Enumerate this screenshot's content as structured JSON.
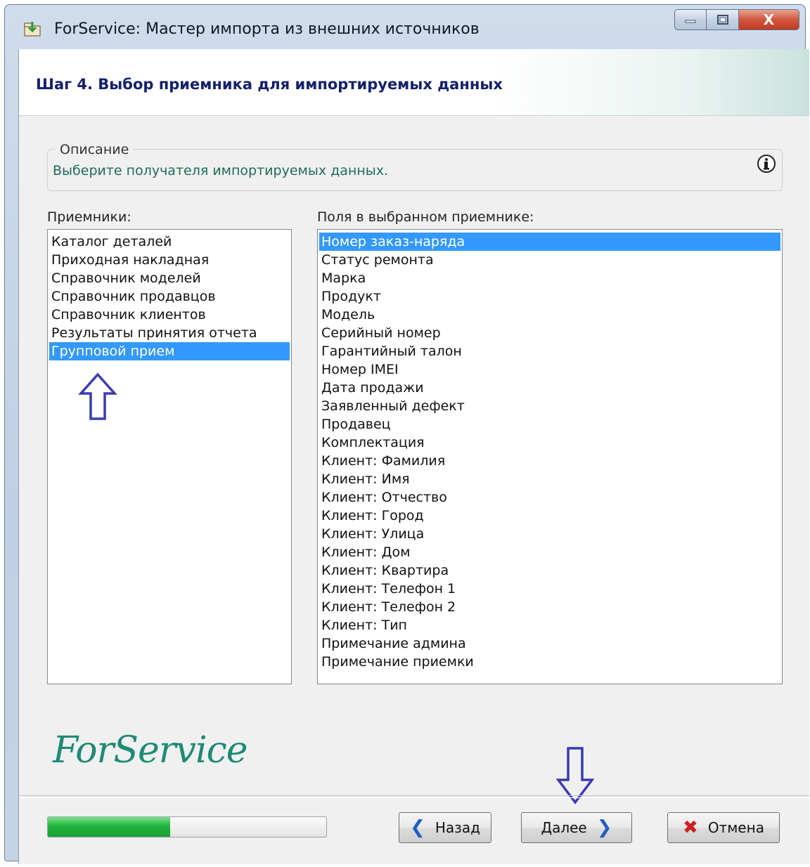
{
  "window": {
    "title": "ForService: Мастер импорта из внешних источников",
    "controls": {
      "minimize": "—",
      "maximize": "□",
      "close": "X"
    }
  },
  "header": {
    "step_title": "Шаг 4. Выбор приемника для импортируемых данных"
  },
  "description": {
    "legend": "Описание",
    "text": "Выберите получателя импортируемых данных."
  },
  "receivers": {
    "label": "Приемники:",
    "items": [
      "Каталог деталей",
      "Приходная накладная",
      "Справочник моделей",
      "Справочник продавцов",
      "Справочник клиентов",
      "Результаты принятия отчета",
      "Групповой прием"
    ],
    "selected_index": 6
  },
  "fields": {
    "label": "Поля в выбранном приемнике:",
    "items": [
      "Номер заказ-наряда",
      "Статус ремонта",
      "Марка",
      "Продукт",
      "Модель",
      "Серийный номер",
      "Гарантийный талон",
      "Номер IMEI",
      "Дата продажи",
      "Заявленный дефект",
      "Продавец",
      "Комплектация",
      "Клиент: Фамилия",
      "Клиент: Имя",
      "Клиент: Отчество",
      "Клиент: Город",
      "Клиент: Улица",
      "Клиент: Дом",
      "Клиент: Квартира",
      "Клиент: Телефон 1",
      "Клиент: Телефон 2",
      "Клиент: Тип",
      "Примечание админа",
      "Примечание приемки"
    ],
    "selected_index": 0
  },
  "logo": {
    "text": "ForService"
  },
  "progress": {
    "value": 0.44
  },
  "buttons": {
    "back": "Назад",
    "next": "Далее",
    "cancel": "Отмена"
  },
  "colors": {
    "selection": "#3399ff",
    "step_title": "#14206e",
    "description_text": "#1f6b5a",
    "logo": "#1e8a76",
    "progress": "#1fb33a",
    "annotation_arrow": "#3b3bb0"
  },
  "icons": {
    "app": "import-icon",
    "info": "info-icon",
    "back": "chevron-left-icon",
    "next": "chevron-right-icon",
    "cancel": "red-x-icon",
    "annotation": "arrow-outline-icon"
  }
}
